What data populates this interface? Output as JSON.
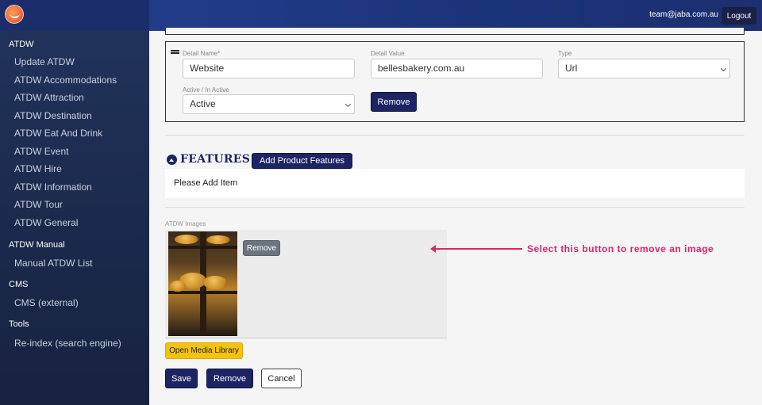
{
  "header": {
    "user_email": "team@jaba.com.au",
    "logout_label": "Logout"
  },
  "sidebar": {
    "sections": [
      {
        "title": "ATDW",
        "items": [
          "Update ATDW",
          "ATDW Accommodations",
          "ATDW Attraction",
          "ATDW Destination",
          "ATDW Eat And Drink",
          "ATDW Event",
          "ATDW Hire",
          "ATDW Information",
          "ATDW Tour",
          "ATDW General"
        ]
      },
      {
        "title": "ATDW Manual",
        "items": [
          "Manual ATDW List"
        ]
      },
      {
        "title": "CMS",
        "items": [
          "CMS (external)"
        ]
      },
      {
        "title": "Tools",
        "items": [
          "Re-index (search engine)"
        ]
      }
    ]
  },
  "detail": {
    "name_label": "Detail Name*",
    "name_value": "Website",
    "value_label": "Detail Value",
    "value_value": "bellesbakery.com.au",
    "type_label": "Type",
    "type_value": "Url",
    "active_label": "Active / In Active",
    "active_value": "Active",
    "remove_label": "Remove"
  },
  "features": {
    "title": "FEATURES",
    "add_label": "Add Product Features",
    "empty_text": "Please Add Item"
  },
  "images": {
    "label": "ATDW Images",
    "remove_label": "Remove",
    "open_media_label": "Open Media Library"
  },
  "annotation": {
    "text": "Select this button to remove an image",
    "color": "#e3226b"
  },
  "actions": {
    "save_label": "Save",
    "remove_label": "Remove",
    "cancel_label": "Cancel"
  }
}
